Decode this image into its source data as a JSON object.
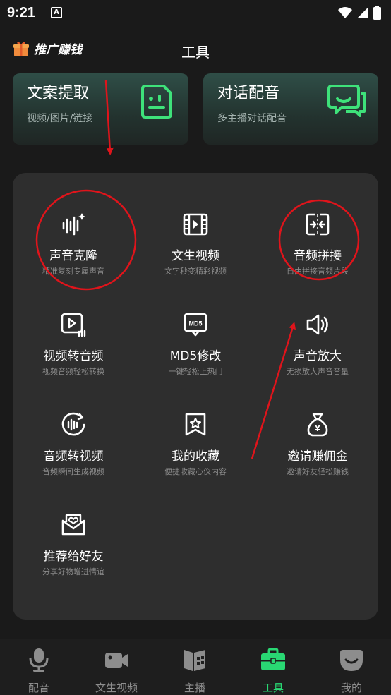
{
  "status_bar": {
    "time": "9:21",
    "notification_badge": "A"
  },
  "header": {
    "promo_label": "推广赚钱",
    "title": "工具"
  },
  "top_cards": [
    {
      "title": "文案提取",
      "subtitle": "视频/图片/链接",
      "icon": "document-face-icon"
    },
    {
      "title": "对话配音",
      "subtitle": "多主播对话配音",
      "icon": "chat-bubbles-icon"
    }
  ],
  "tools": [
    {
      "title": "声音克隆",
      "subtitle": "精准复刻专属声音",
      "icon": "sound-wave-sparkle-icon"
    },
    {
      "title": "文生视频",
      "subtitle": "文字秒变精彩视频",
      "icon": "film-icon"
    },
    {
      "title": "音频拼接",
      "subtitle": "自由拼接音频片段",
      "icon": "merge-icon"
    },
    {
      "title": "视频转音频",
      "subtitle": "视频音频轻松转换",
      "icon": "video-to-audio-icon"
    },
    {
      "title": "MD5修改",
      "subtitle": "一键轻松上热门",
      "icon": "md5-monitor-icon",
      "icon_text": "MD5"
    },
    {
      "title": "声音放大",
      "subtitle": "无损放大声音音量",
      "icon": "speaker-icon"
    },
    {
      "title": "音频转视频",
      "subtitle": "音频瞬间生成视频",
      "icon": "audio-circle-icon"
    },
    {
      "title": "我的收藏",
      "subtitle": "便捷收藏心仪内容",
      "icon": "bookmark-star-icon"
    },
    {
      "title": "邀请赚佣金",
      "subtitle": "邀请好友轻松赚钱",
      "icon": "money-bag-icon",
      "icon_text": "¥"
    },
    {
      "title": "推荐给好友",
      "subtitle": "分享好物增进情谊",
      "icon": "heart-envelope-icon"
    }
  ],
  "tab_bar": {
    "active_color": "#29d873",
    "inactive_color": "#8d8d8d",
    "tabs": [
      {
        "label": "配音",
        "icon": "microphone-icon",
        "active": false
      },
      {
        "label": "文生视频",
        "icon": "video-camera-icon",
        "active": false
      },
      {
        "label": "主播",
        "icon": "book-grid-icon",
        "active": false
      },
      {
        "label": "工具",
        "icon": "toolbox-icon",
        "active": true
      },
      {
        "label": "我的",
        "icon": "profile-face-icon",
        "active": false
      }
    ]
  },
  "colors": {
    "background": "#1a1a1a",
    "panel": "#2e2e2e",
    "accent": "#29d873",
    "annotation": "#e0141b"
  }
}
